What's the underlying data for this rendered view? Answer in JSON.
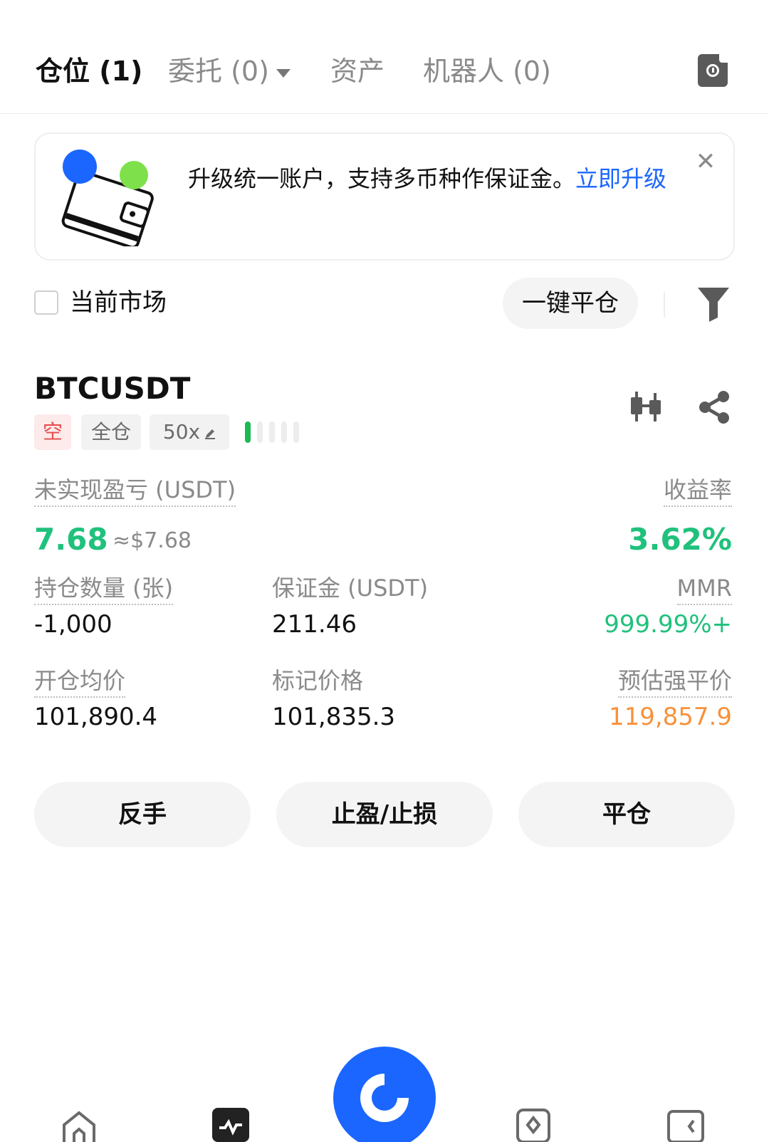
{
  "tabs": {
    "positions": "仓位 (1)",
    "orders": "委托 (0)",
    "assets": "资产",
    "bots": "机器人 (0)"
  },
  "banner": {
    "text": "升级统一账户，支持多币种作保证金。",
    "link": "立即升级",
    "close": "✕"
  },
  "filter": {
    "current_market": "当前市场",
    "close_all": "一键平仓"
  },
  "position": {
    "symbol": "BTCUSDT",
    "side": "空",
    "margin_mode": "全仓",
    "leverage": "50x",
    "risk_level_bars": 5,
    "risk_level_active": 1,
    "unrealized_pnl_label": "未实现盈亏 (USDT)",
    "unrealized_pnl": "7.68",
    "unrealized_pnl_usd": "≈$7.68",
    "roe_label": "收益率",
    "roe": "3.62%",
    "size_label": "持仓数量 (张)",
    "size": "-1,000",
    "margin_label": "保证金 (USDT)",
    "margin": "211.46",
    "mmr_label": "MMR",
    "mmr": "999.99%+",
    "entry_price_label": "开仓均价",
    "entry_price": "101,890.4",
    "mark_price_label": "标记价格",
    "mark_price": "101,835.3",
    "liq_price_label": "预估强平价",
    "liq_price": "119,857.9"
  },
  "actions": {
    "reverse": "反手",
    "tp_sl": "止盈/止损",
    "close": "平仓"
  },
  "colors": {
    "accent": "#1a66ff",
    "profit": "#20c17c",
    "short": "#e74c4c",
    "liquidation": "#f7923b"
  },
  "icons": [
    "history-icon",
    "close-icon",
    "filter-funnel-icon",
    "candlestick-icon",
    "share-icon",
    "home-icon",
    "markets-icon",
    "trade-fab-icon",
    "discover-icon",
    "wallet-icon"
  ]
}
